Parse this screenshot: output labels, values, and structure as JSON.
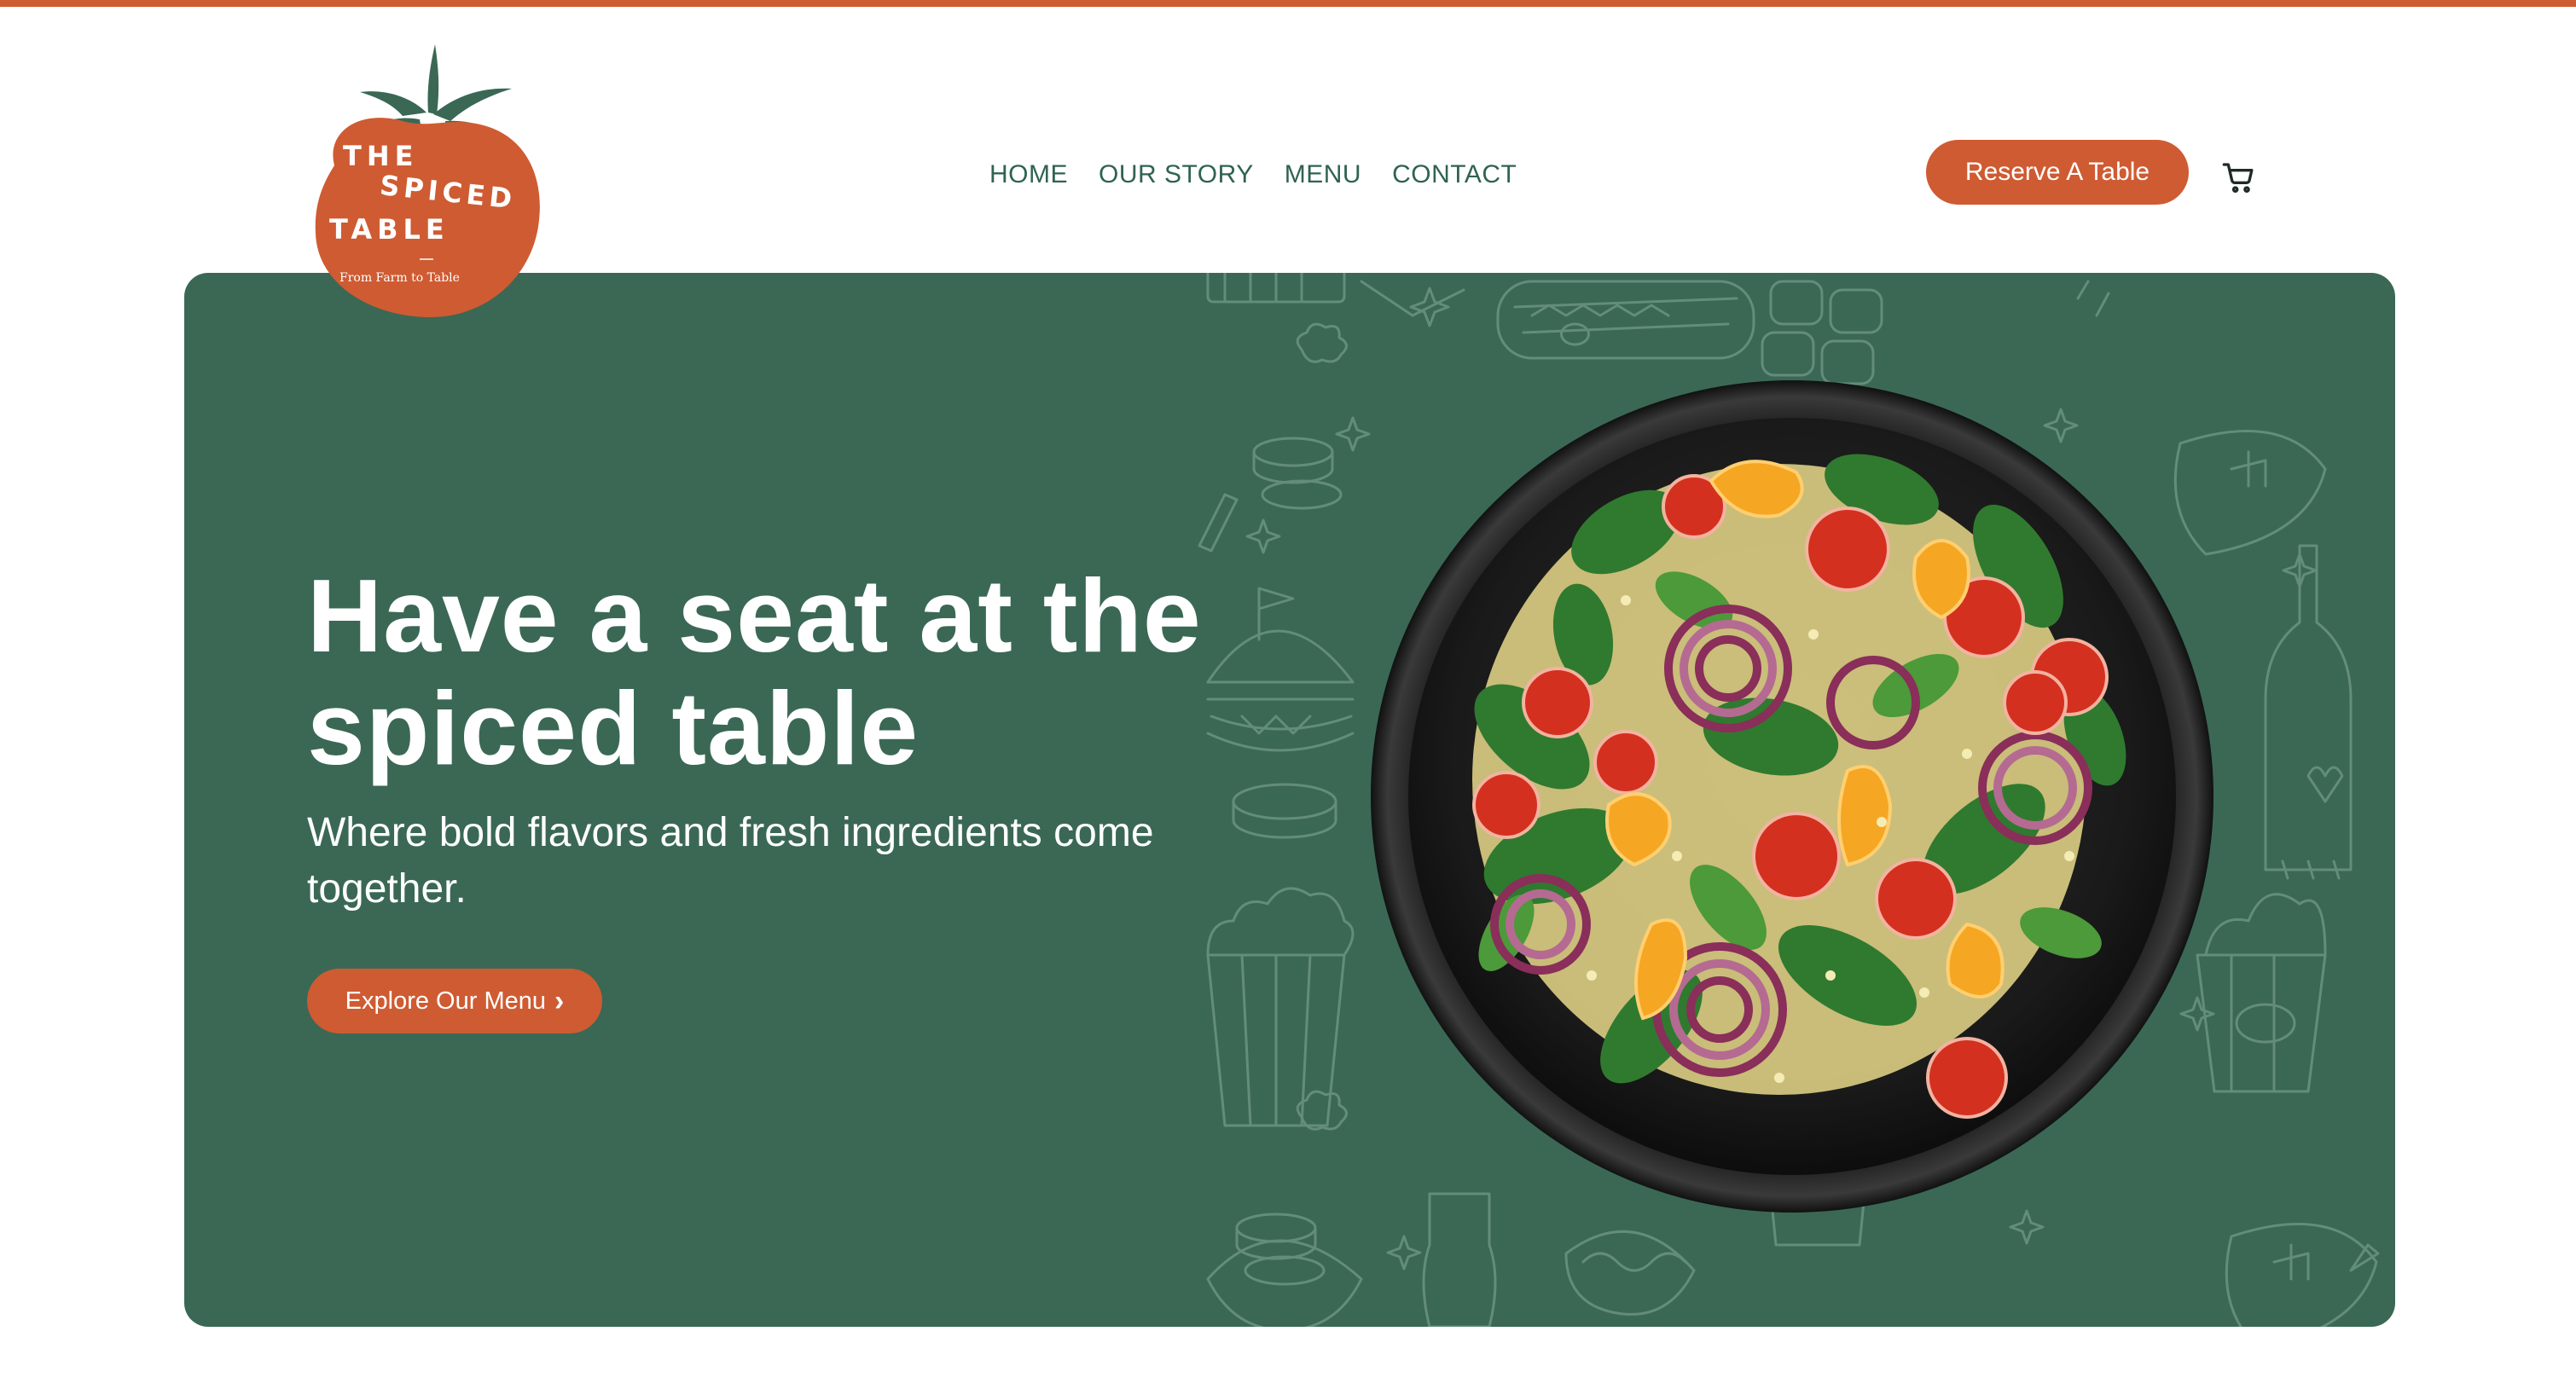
{
  "colors": {
    "accent": "#cf5b32",
    "hero_green": "#3a6855",
    "nav_text": "#2f6350",
    "white": "#ffffff"
  },
  "logo": {
    "line1": "THE",
    "line2": "SPICED",
    "line3": "TABLE",
    "tagline": "From Farm to Table",
    "icon": "tomato-logo"
  },
  "nav": {
    "items": [
      {
        "label": "HOME"
      },
      {
        "label": "OUR STORY"
      },
      {
        "label": "MENU"
      },
      {
        "label": "CONTACT"
      }
    ]
  },
  "header": {
    "reserve_label": "Reserve A Table",
    "cart_icon": "cart-icon"
  },
  "hero": {
    "headline": "Have a seat at the spiced table",
    "subheadline": "Where bold flavors and fresh ingredients come together.",
    "cta_label": "Explore Our Menu",
    "cta_icon": "chevron-right-icon",
    "image": "salad-bowl-image",
    "background": "food-doodle-pattern"
  }
}
